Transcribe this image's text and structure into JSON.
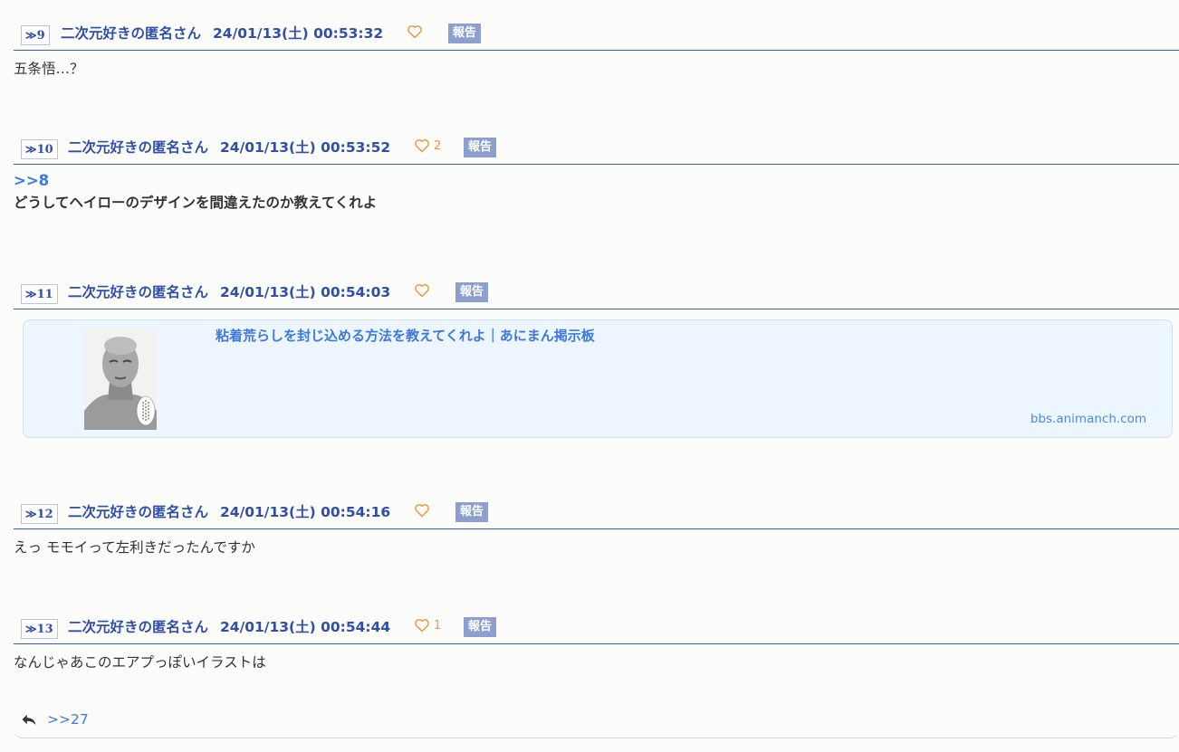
{
  "posts": [
    {
      "num_arrow": "≫",
      "num": "9",
      "name": "二次元好きの匿名さん",
      "date": "24/01/13(土) 00:53:32",
      "likes": "",
      "report": "報告",
      "text": "五条悟…？"
    },
    {
      "num_arrow": "≫",
      "num": "10",
      "name": "二次元好きの匿名さん",
      "date": "24/01/13(土) 00:53:52",
      "likes": "2",
      "report": "報告",
      "anchor": ">>8",
      "text": "どうしてヘイローのデザインを間違えたのか教えてくれよ"
    },
    {
      "num_arrow": "≫",
      "num": "11",
      "name": "二次元好きの匿名さん",
      "date": "24/01/13(土) 00:54:03",
      "likes": "",
      "report": "報告",
      "card": {
        "title": "粘着荒らしを封じ込める方法を教えてくれよ｜あにまん掲示板",
        "domain": "bbs.animanch.com"
      }
    },
    {
      "num_arrow": "≫",
      "num": "12",
      "name": "二次元好きの匿名さん",
      "date": "24/01/13(土) 00:54:16",
      "likes": "",
      "report": "報告",
      "text": "えっ モモイって左利きだったんですか"
    },
    {
      "num_arrow": "≫",
      "num": "13",
      "name": "二次元好きの匿名さん",
      "date": "24/01/13(土) 00:54:44",
      "likes": "1",
      "report": "報告",
      "text": "なんじゃあこのエアプっぽいイラストは"
    }
  ],
  "footer": {
    "reply_link": ">>27"
  },
  "colors": {
    "header_blue": "#2f4fa8",
    "link_blue": "#3d79df",
    "heart_orange": "#e8963a",
    "report_bg": "#8d9fcf",
    "card_bg": "#edf6fe"
  }
}
